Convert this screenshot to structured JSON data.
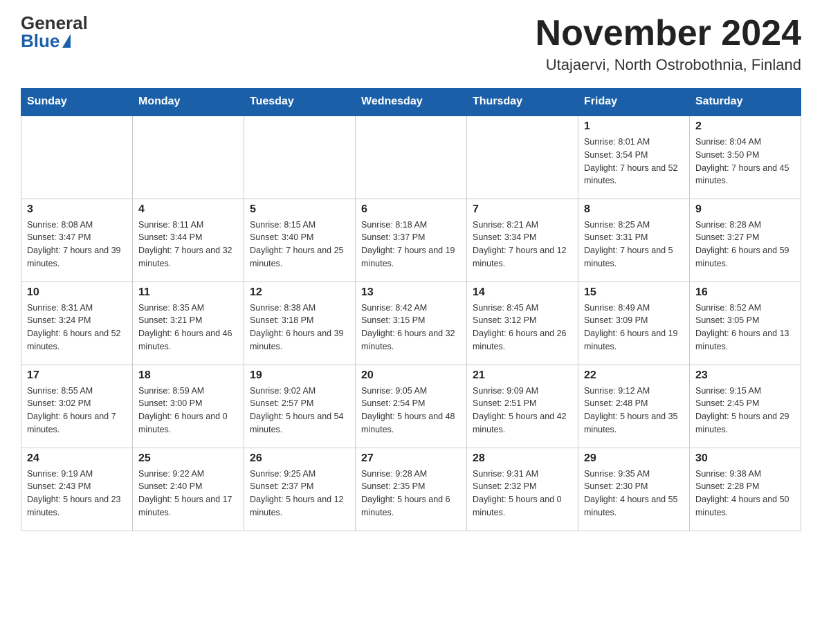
{
  "header": {
    "logo_general": "General",
    "logo_blue": "Blue",
    "month_title": "November 2024",
    "location": "Utajaervi, North Ostrobothnia, Finland"
  },
  "days_of_week": [
    "Sunday",
    "Monday",
    "Tuesday",
    "Wednesday",
    "Thursday",
    "Friday",
    "Saturday"
  ],
  "weeks": [
    [
      {
        "day": "",
        "info": ""
      },
      {
        "day": "",
        "info": ""
      },
      {
        "day": "",
        "info": ""
      },
      {
        "day": "",
        "info": ""
      },
      {
        "day": "",
        "info": ""
      },
      {
        "day": "1",
        "info": "Sunrise: 8:01 AM\nSunset: 3:54 PM\nDaylight: 7 hours and 52 minutes."
      },
      {
        "day": "2",
        "info": "Sunrise: 8:04 AM\nSunset: 3:50 PM\nDaylight: 7 hours and 45 minutes."
      }
    ],
    [
      {
        "day": "3",
        "info": "Sunrise: 8:08 AM\nSunset: 3:47 PM\nDaylight: 7 hours and 39 minutes."
      },
      {
        "day": "4",
        "info": "Sunrise: 8:11 AM\nSunset: 3:44 PM\nDaylight: 7 hours and 32 minutes."
      },
      {
        "day": "5",
        "info": "Sunrise: 8:15 AM\nSunset: 3:40 PM\nDaylight: 7 hours and 25 minutes."
      },
      {
        "day": "6",
        "info": "Sunrise: 8:18 AM\nSunset: 3:37 PM\nDaylight: 7 hours and 19 minutes."
      },
      {
        "day": "7",
        "info": "Sunrise: 8:21 AM\nSunset: 3:34 PM\nDaylight: 7 hours and 12 minutes."
      },
      {
        "day": "8",
        "info": "Sunrise: 8:25 AM\nSunset: 3:31 PM\nDaylight: 7 hours and 5 minutes."
      },
      {
        "day": "9",
        "info": "Sunrise: 8:28 AM\nSunset: 3:27 PM\nDaylight: 6 hours and 59 minutes."
      }
    ],
    [
      {
        "day": "10",
        "info": "Sunrise: 8:31 AM\nSunset: 3:24 PM\nDaylight: 6 hours and 52 minutes."
      },
      {
        "day": "11",
        "info": "Sunrise: 8:35 AM\nSunset: 3:21 PM\nDaylight: 6 hours and 46 minutes."
      },
      {
        "day": "12",
        "info": "Sunrise: 8:38 AM\nSunset: 3:18 PM\nDaylight: 6 hours and 39 minutes."
      },
      {
        "day": "13",
        "info": "Sunrise: 8:42 AM\nSunset: 3:15 PM\nDaylight: 6 hours and 32 minutes."
      },
      {
        "day": "14",
        "info": "Sunrise: 8:45 AM\nSunset: 3:12 PM\nDaylight: 6 hours and 26 minutes."
      },
      {
        "day": "15",
        "info": "Sunrise: 8:49 AM\nSunset: 3:09 PM\nDaylight: 6 hours and 19 minutes."
      },
      {
        "day": "16",
        "info": "Sunrise: 8:52 AM\nSunset: 3:05 PM\nDaylight: 6 hours and 13 minutes."
      }
    ],
    [
      {
        "day": "17",
        "info": "Sunrise: 8:55 AM\nSunset: 3:02 PM\nDaylight: 6 hours and 7 minutes."
      },
      {
        "day": "18",
        "info": "Sunrise: 8:59 AM\nSunset: 3:00 PM\nDaylight: 6 hours and 0 minutes."
      },
      {
        "day": "19",
        "info": "Sunrise: 9:02 AM\nSunset: 2:57 PM\nDaylight: 5 hours and 54 minutes."
      },
      {
        "day": "20",
        "info": "Sunrise: 9:05 AM\nSunset: 2:54 PM\nDaylight: 5 hours and 48 minutes."
      },
      {
        "day": "21",
        "info": "Sunrise: 9:09 AM\nSunset: 2:51 PM\nDaylight: 5 hours and 42 minutes."
      },
      {
        "day": "22",
        "info": "Sunrise: 9:12 AM\nSunset: 2:48 PM\nDaylight: 5 hours and 35 minutes."
      },
      {
        "day": "23",
        "info": "Sunrise: 9:15 AM\nSunset: 2:45 PM\nDaylight: 5 hours and 29 minutes."
      }
    ],
    [
      {
        "day": "24",
        "info": "Sunrise: 9:19 AM\nSunset: 2:43 PM\nDaylight: 5 hours and 23 minutes."
      },
      {
        "day": "25",
        "info": "Sunrise: 9:22 AM\nSunset: 2:40 PM\nDaylight: 5 hours and 17 minutes."
      },
      {
        "day": "26",
        "info": "Sunrise: 9:25 AM\nSunset: 2:37 PM\nDaylight: 5 hours and 12 minutes."
      },
      {
        "day": "27",
        "info": "Sunrise: 9:28 AM\nSunset: 2:35 PM\nDaylight: 5 hours and 6 minutes."
      },
      {
        "day": "28",
        "info": "Sunrise: 9:31 AM\nSunset: 2:32 PM\nDaylight: 5 hours and 0 minutes."
      },
      {
        "day": "29",
        "info": "Sunrise: 9:35 AM\nSunset: 2:30 PM\nDaylight: 4 hours and 55 minutes."
      },
      {
        "day": "30",
        "info": "Sunrise: 9:38 AM\nSunset: 2:28 PM\nDaylight: 4 hours and 50 minutes."
      }
    ]
  ]
}
